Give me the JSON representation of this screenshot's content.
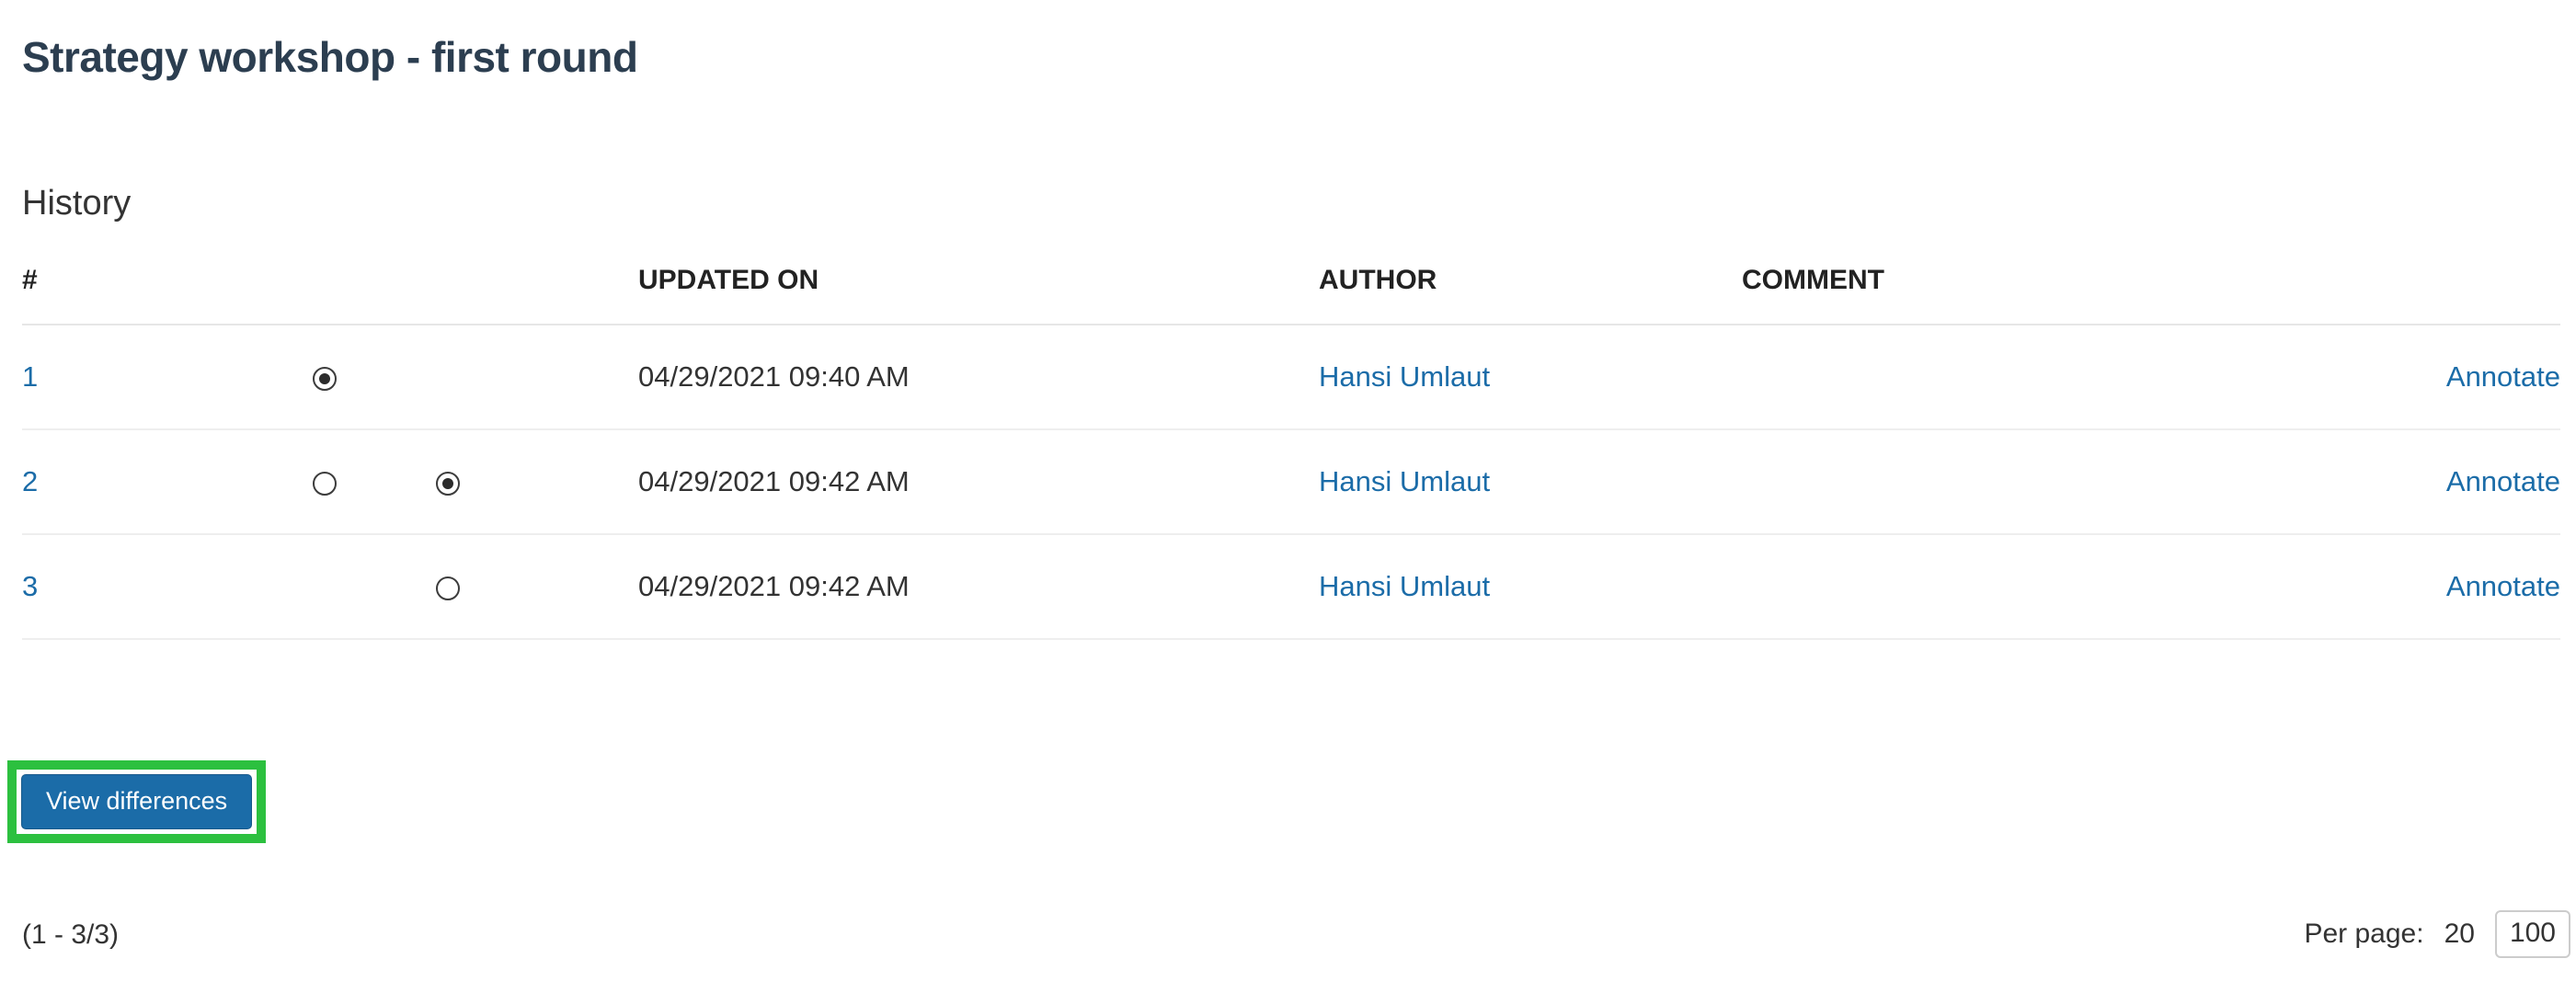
{
  "page": {
    "title": "Strategy workshop - first round",
    "section_heading": "History"
  },
  "table": {
    "headers": {
      "num": "#",
      "radio_a": "",
      "radio_b": "",
      "updated_on": "UPDATED ON",
      "author": "AUTHOR",
      "comment": "COMMENT",
      "action": ""
    },
    "rows": [
      {
        "num": "1",
        "radio_a": "checked",
        "radio_b": "none",
        "updated_on": "04/29/2021 09:40 AM",
        "author": "Hansi Umlaut",
        "comment": "",
        "action": "Annotate"
      },
      {
        "num": "2",
        "radio_a": "unchecked",
        "radio_b": "checked",
        "updated_on": "04/29/2021 09:42 AM",
        "author": "Hansi Umlaut",
        "comment": "",
        "action": "Annotate"
      },
      {
        "num": "3",
        "radio_a": "none",
        "radio_b": "unchecked",
        "updated_on": "04/29/2021 09:42 AM",
        "author": "Hansi Umlaut",
        "comment": "",
        "action": "Annotate"
      }
    ]
  },
  "actions": {
    "view_differences_label": "View differences"
  },
  "footer": {
    "range": "(1 - 3/3)",
    "per_page_label": "Per page:",
    "per_page_options": [
      "20",
      "100"
    ],
    "per_page_selected": "100"
  },
  "colors": {
    "link": "#1b6ca8",
    "button_primary": "#1b6ca8",
    "highlight": "#2cc03f",
    "title": "#2c3e50",
    "divider": "#e6e6e6"
  }
}
